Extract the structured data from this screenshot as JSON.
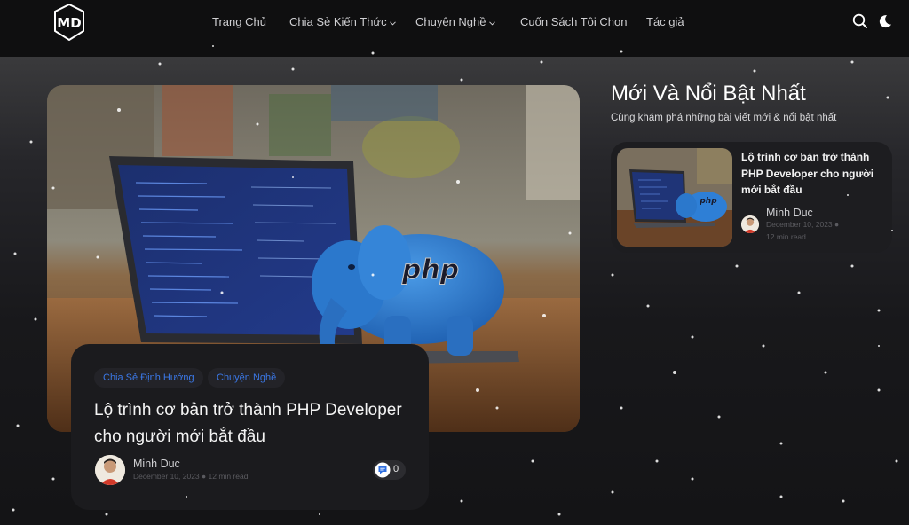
{
  "header": {
    "logo_text": "MD",
    "nav": [
      {
        "label": "Trang Chủ",
        "has_dropdown": false
      },
      {
        "label": "Chia Sẻ Kiến Thức",
        "has_dropdown": true
      },
      {
        "label": "Chuyện Nghề",
        "has_dropdown": true
      },
      {
        "label": "Cuốn Sách Tôi Chọn",
        "has_dropdown": false
      },
      {
        "label": "Tác giả",
        "has_dropdown": false
      }
    ],
    "icons": [
      "search-icon",
      "dark-mode-moon-icon"
    ]
  },
  "featured": {
    "tags": [
      "Chia Sẻ Định Hướng",
      "Chuyện Nghề"
    ],
    "title": "Lộ trình cơ bản trở thành PHP Developer cho người mới bắt đầu",
    "author": "Minh Duc",
    "date": "December 10, 2023",
    "read_time": "12 min read",
    "comment_count": "0",
    "image_logo_text": "php"
  },
  "side_section": {
    "title": "Mới Và Nổi Bật Nhất",
    "subtitle": "Cùng khám phá những bài viết mới & nổi bật nhất",
    "posts": [
      {
        "title": "Lộ trình cơ bản trở thành PHP Developer cho người mới bắt đầu",
        "author": "Minh Duc",
        "date": "December 10, 2023",
        "read_time": "12 min read",
        "image_logo_text": "php"
      }
    ]
  },
  "colors": {
    "tag_text": "#3b78e7",
    "accent_blue": "#2f6fe0",
    "background": "#141416"
  }
}
